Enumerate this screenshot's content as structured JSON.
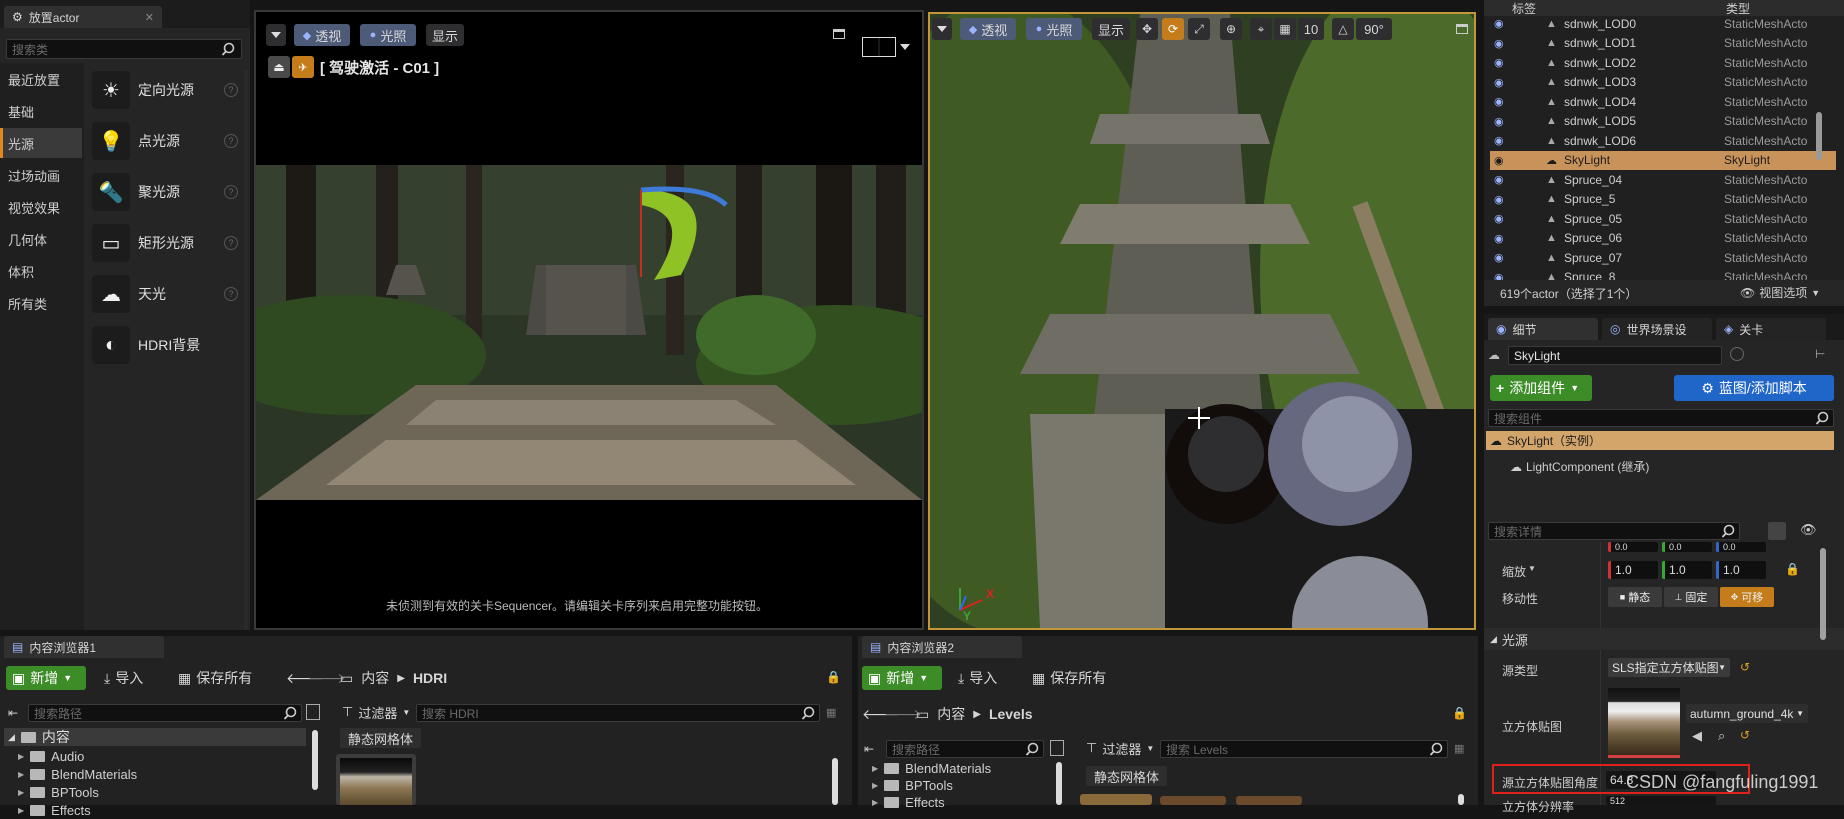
{
  "place_panel": {
    "tab_title": "放置actor",
    "search_placeholder": "搜索类",
    "categories": [
      "最近放置",
      "基础",
      "光源",
      "过场动画",
      "视觉效果",
      "几何体",
      "体积",
      "所有类"
    ],
    "selected_category": "光源",
    "items": [
      "定向光源",
      "点光源",
      "聚光源",
      "矩形光源",
      "天光",
      "HDRI背景"
    ]
  },
  "viewport_left": {
    "btn_perspective": "透视",
    "btn_lighting": "光照",
    "btn_show": "显示",
    "pilot_label": "[ 驾驶激活 - C01 ]",
    "sequencer_notice": "未侦测到有效的关卡Sequencer。请编辑关卡序列来启用完整功能按钮。"
  },
  "viewport_right": {
    "btn_perspective": "透视",
    "btn_lighting": "光照",
    "btn_show": "显示",
    "grid_value": "10",
    "angle_value": "90°",
    "gizmo_x": "X",
    "gizmo_y": "Y"
  },
  "outliner": {
    "col_label": "标签",
    "col_type": "类型",
    "rows": [
      {
        "label": "sdnwk_LOD0",
        "type": "StaticMeshActo"
      },
      {
        "label": "sdnwk_LOD1",
        "type": "StaticMeshActo"
      },
      {
        "label": "sdnwk_LOD2",
        "type": "StaticMeshActo"
      },
      {
        "label": "sdnwk_LOD3",
        "type": "StaticMeshActo"
      },
      {
        "label": "sdnwk_LOD4",
        "type": "StaticMeshActo"
      },
      {
        "label": "sdnwk_LOD5",
        "type": "StaticMeshActo"
      },
      {
        "label": "sdnwk_LOD6",
        "type": "StaticMeshActo"
      },
      {
        "label": "SkyLight",
        "type": "SkyLight"
      },
      {
        "label": "Spruce_04",
        "type": "StaticMeshActo"
      },
      {
        "label": "Spruce_5",
        "type": "StaticMeshActo"
      },
      {
        "label": "Spruce_05",
        "type": "StaticMeshActo"
      },
      {
        "label": "Spruce_06",
        "type": "StaticMeshActo"
      },
      {
        "label": "Spruce_07",
        "type": "StaticMeshActo"
      },
      {
        "label": "Spruce_8",
        "type": "StaticMeshActo"
      }
    ],
    "selected_index": 7,
    "count_text": "619个actor（选择了1个）",
    "view_options": "视图选项"
  },
  "details": {
    "tabs": [
      "细节",
      "世界场景设",
      "关卡"
    ],
    "actor_name": "SkyLight",
    "add_component": "添加组件",
    "blueprint_button": "蓝图/添加脚本",
    "search_components_placeholder": "搜索组件",
    "component_root": "SkyLight（实例）",
    "component_child": "LightComponent (继承)",
    "search_details_placeholder": "搜索详情",
    "rotation_values": [
      "0.0",
      "0.0",
      "0.0"
    ],
    "scale_label": "缩放",
    "scale_values": [
      "1.0",
      "1.0",
      "1.0"
    ],
    "mobility_label": "移动性",
    "mobility_options": [
      "静态",
      "固定",
      "可移"
    ],
    "light_section": "光源",
    "source_type_label": "源类型",
    "source_type_value": "SLS指定立方体贴图",
    "cubemap_label": "立方体贴图",
    "cubemap_asset": "autumn_ground_4k",
    "cubemap_angle_label": "源立方体贴图角度",
    "cubemap_angle_value": "64.8",
    "resolution_label": "立方体分辨率",
    "resolution_value": "512",
    "accent_highlight": "#e0201a"
  },
  "content_browser_1": {
    "tab_title": "内容浏览器1",
    "new_button": "新增",
    "import_button": "导入",
    "save_all_button": "保存所有",
    "breadcrumb_root": "内容",
    "breadcrumb_current": "HDRI",
    "search_paths_placeholder": "搜索路径",
    "filter_button": "过滤器",
    "search_placeholder": "搜索 HDRI",
    "filter_chip": "静态网格体",
    "tree_root": "内容",
    "tree_items": [
      "Audio",
      "BlendMaterials",
      "BPTools",
      "Effects"
    ]
  },
  "content_browser_2": {
    "tab_title": "内容浏览器2",
    "new_button": "新增",
    "import_button": "导入",
    "save_all_button": "保存所有",
    "breadcrumb_root": "内容",
    "breadcrumb_current": "Levels",
    "search_paths_placeholder": "搜索路径",
    "filter_button": "过滤器",
    "search_placeholder": "搜索 Levels",
    "filter_chip": "静态网格体",
    "tree_items": [
      "BlendMaterials",
      "BPTools",
      "Effects"
    ]
  },
  "watermark": "CSDN @fangfuling1991"
}
